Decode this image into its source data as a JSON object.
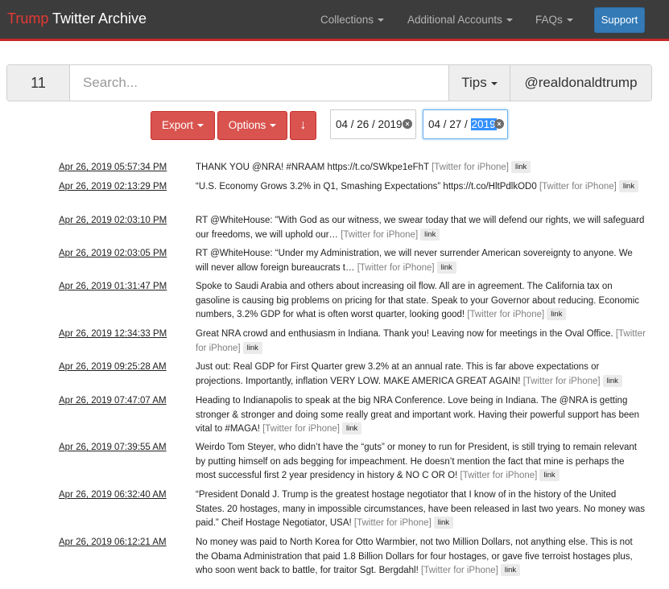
{
  "app": {
    "brand_highlight": "Trump",
    "brand_rest": "Twitter Archive"
  },
  "nav": {
    "collections": "Collections",
    "additional_accounts": "Additional Accounts",
    "faqs": "FAQs",
    "support": "Support"
  },
  "search": {
    "count": "11",
    "placeholder": "Search...",
    "tips": "Tips",
    "account": "@realdonaldtrump"
  },
  "toolbar": {
    "export": "Export",
    "options": "Options",
    "sort_icon": "↓",
    "date_start": "04 / 26 / 2019",
    "date_end_prefix": "04 / 27 / ",
    "date_end_selected": "2019"
  },
  "tweets": [
    {
      "date": "Apr 26, 2019 05:57:34 PM",
      "text": "THANK YOU @NRA! #NRAAM https://t.co/SWkpe1eFhT",
      "source": "[Twitter for iPhone]",
      "link": "link"
    },
    {
      "date": "Apr 26, 2019 02:13:29 PM",
      "text": "“U.S. Economy Grows 3.2% in Q1, Smashing Expectations” https://t.co/HltPdlkOD0",
      "source": "[Twitter for iPhone]",
      "link": "link"
    },
    {
      "date": "Apr 26, 2019 02:03:10 PM",
      "text": "RT @WhiteHouse: \"With God as our witness, we swear today that we will defend our rights, we will safeguard our freedoms, we will uphold our…",
      "source": "[Twitter for iPhone]",
      "link": "link"
    },
    {
      "date": "Apr 26, 2019 02:03:05 PM",
      "text": "RT @WhiteHouse: “Under my Administration, we will never surrender American sovereignty to anyone. We will never allow foreign bureaucrats t…",
      "source": "[Twitter for iPhone]",
      "link": "link"
    },
    {
      "date": "Apr 26, 2019 01:31:47 PM",
      "text": "Spoke to Saudi Arabia and others about increasing oil flow. All are in agreement. The California tax on gasoline is causing big problems on pricing for that state. Speak to your Governor about reducing. Economic numbers, 3.2% GDP for what is often worst quarter, looking good!",
      "source": "[Twitter for iPhone]",
      "link": "link"
    },
    {
      "date": "Apr 26, 2019 12:34:33 PM",
      "text": "Great NRA crowd and enthusiasm in Indiana. Thank you! Leaving now for meetings in the Oval Office.",
      "source": "[Twitter for iPhone]",
      "link": "link"
    },
    {
      "date": "Apr 26, 2019 09:25:28 AM",
      "text": "Just out: Real GDP for First Quarter grew 3.2% at an annual rate. This is far above expectations or projections. Importantly, inflation VERY LOW. MAKE AMERICA GREAT AGAIN!",
      "source": "[Twitter for iPhone]",
      "link": "link"
    },
    {
      "date": "Apr 26, 2019 07:47:07 AM",
      "text": "Heading to Indianapolis to speak at the big NRA Conference. Love being in Indiana. The @NRA is getting stronger & stronger and doing some really great and important work. Having their powerful support has been vital to #MAGA!",
      "source": "[Twitter for iPhone]",
      "link": "link"
    },
    {
      "date": "Apr 26, 2019 07:39:55 AM",
      "text": "Weirdo Tom Steyer, who didn’t have the “guts” or money to run for President, is still trying to remain relevant by putting himself on ads begging for impeachment. He doesn’t mention the fact that mine is perhaps the most successful first 2 year presidency in history & NO C OR O!",
      "source": "[Twitter for iPhone]",
      "link": "link"
    },
    {
      "date": "Apr 26, 2019 06:32:40 AM",
      "text": "“President Donald J. Trump is the greatest hostage negotiator that I know of in the history of the United States. 20 hostages, many in impossible circumstances, have been released in last two years. No money was paid.” Cheif Hostage Negotiator, USA!",
      "source": "[Twitter for iPhone]",
      "link": "link"
    },
    {
      "date": "Apr 26, 2019 06:12:21 AM",
      "text": "No money was paid to North Korea for Otto Warmbier, not two Million Dollars, not anything else. This is not the Obama Administration that paid 1.8 Billion Dollars for four hostages, or gave five terroist hostages plus, who soon went back to battle, for traitor Sgt. Bergdahl!",
      "source": "[Twitter for iPhone]",
      "link": "link"
    }
  ],
  "colors": {
    "navbar": "#3c3c3c",
    "brand_red": "#e53935",
    "accent_red": "#d9534f",
    "support_blue": "#337ab7"
  }
}
